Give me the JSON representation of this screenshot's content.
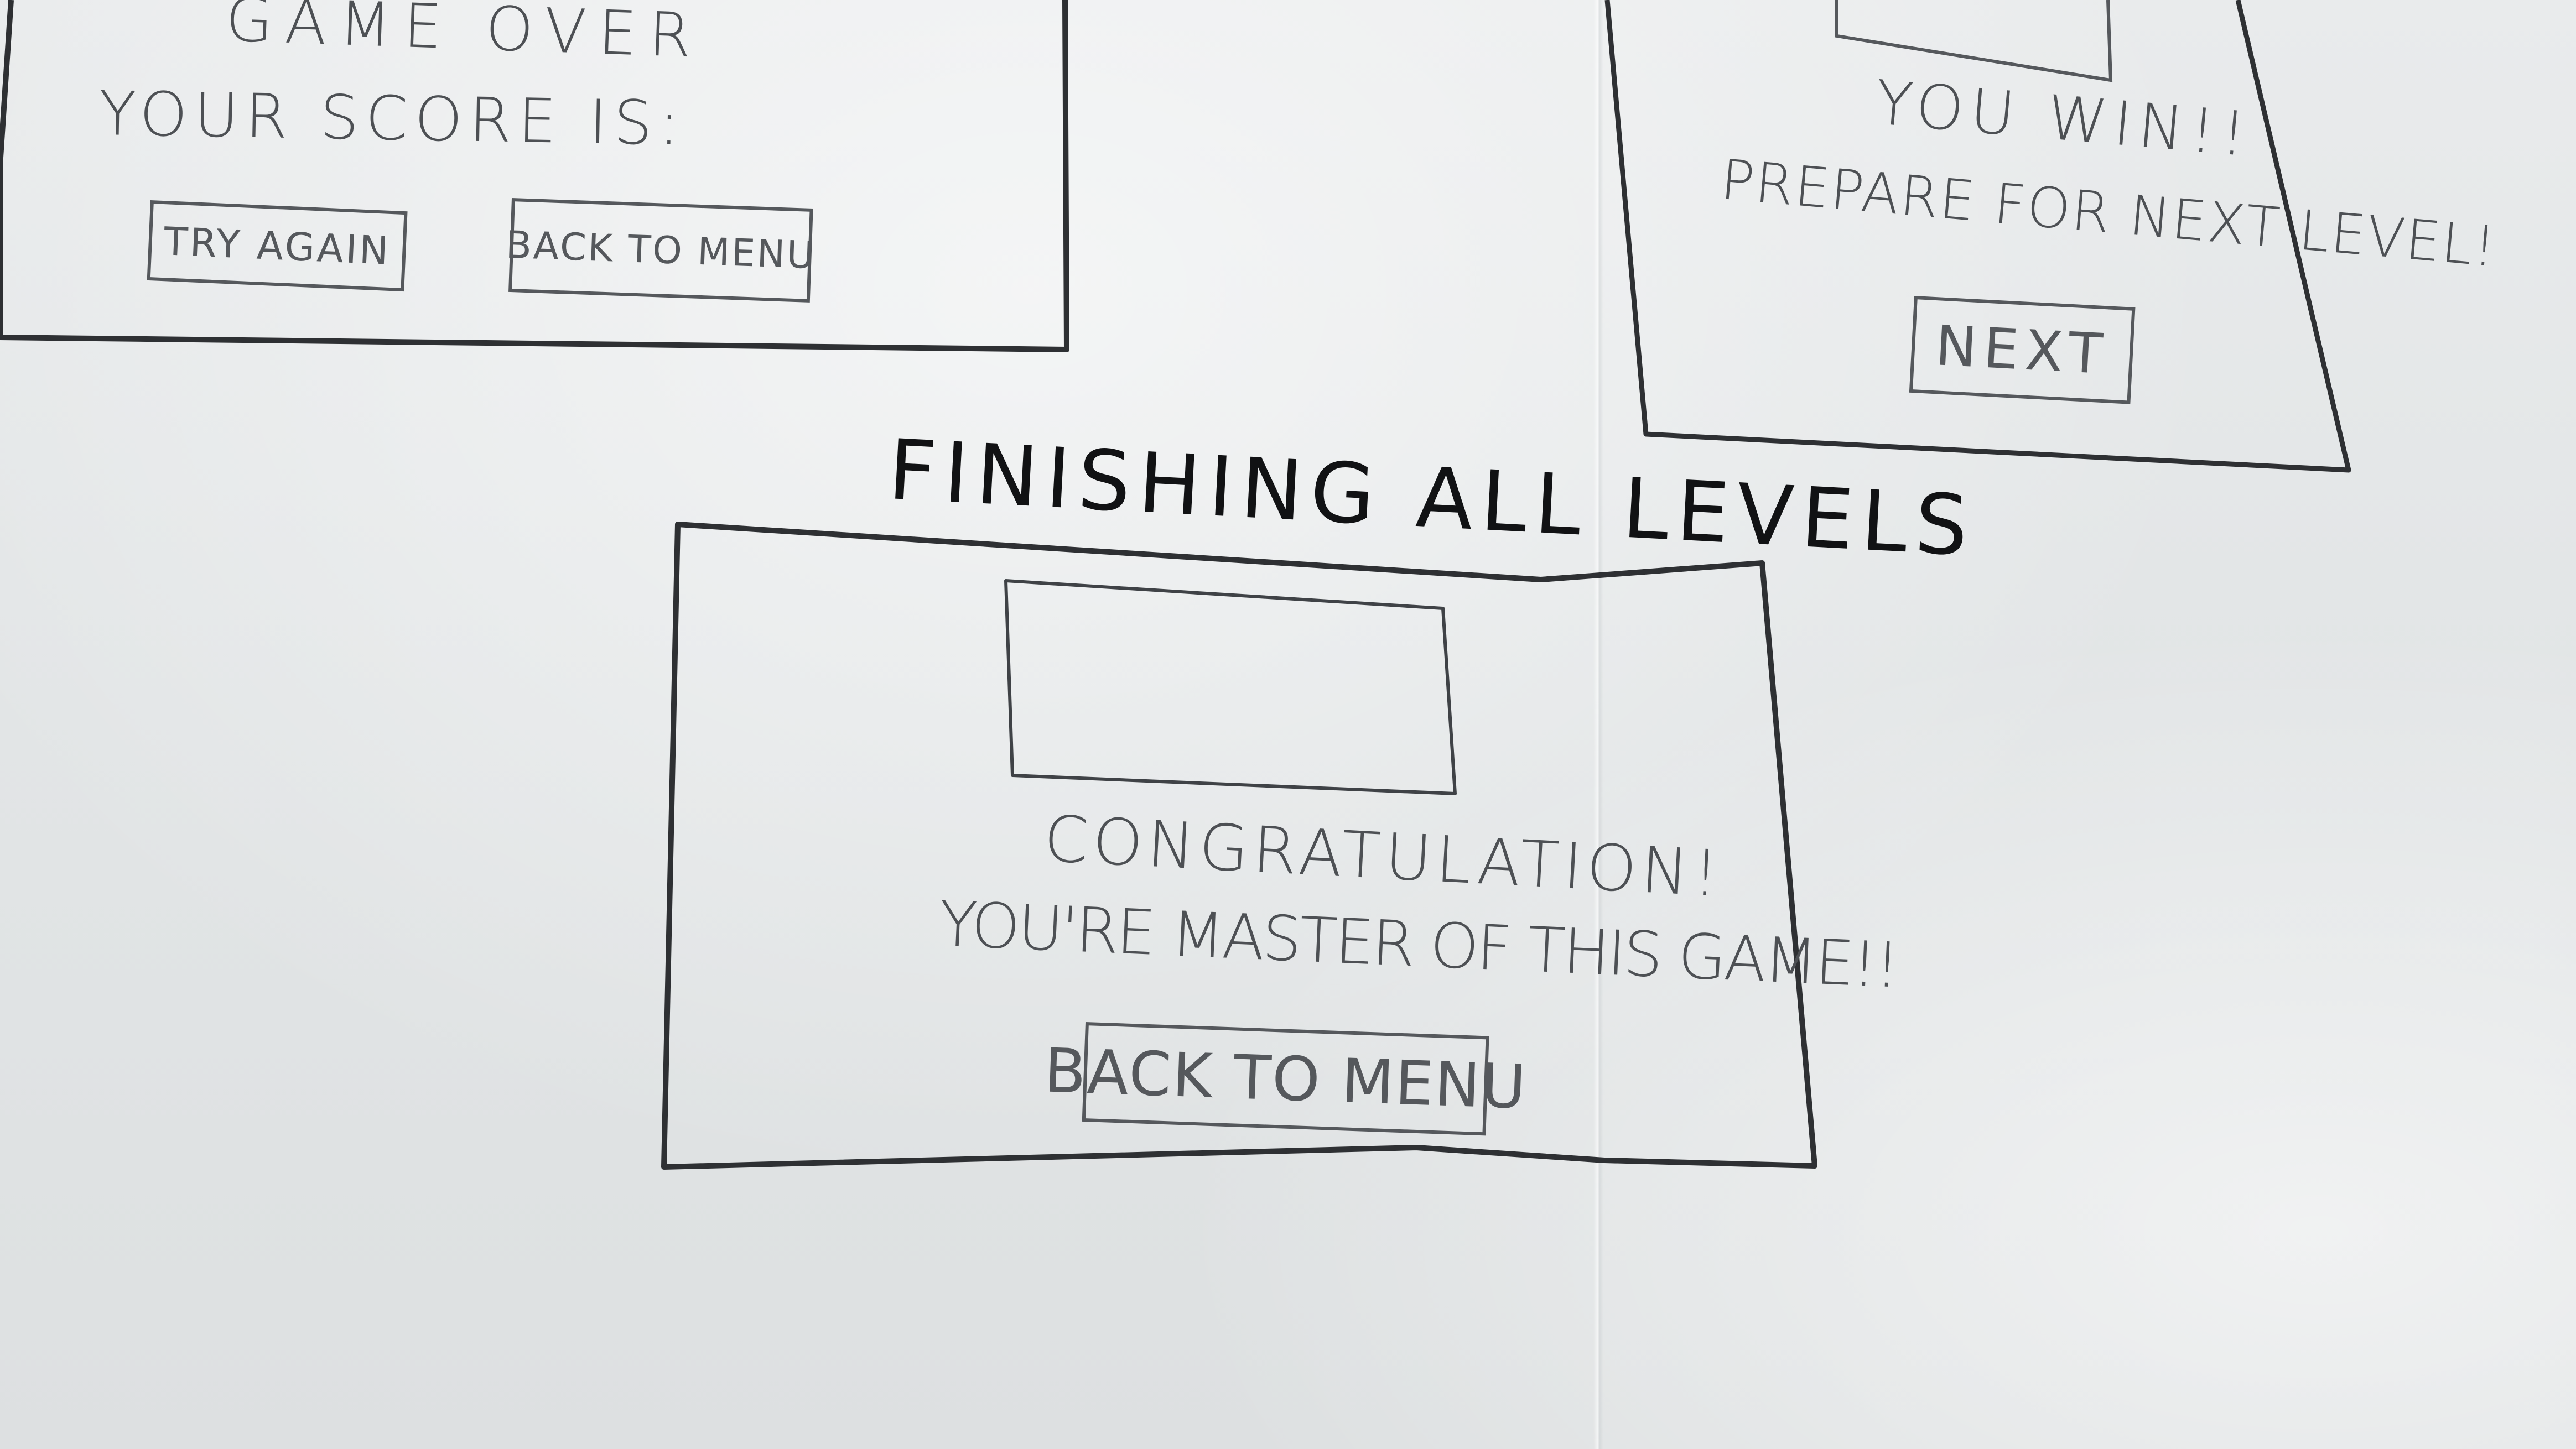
{
  "game_over_screen": {
    "heading": "GAME OVER",
    "score_label": "YOUR SCORE IS:",
    "try_again_label": "TRY AGAIN",
    "back_to_menu_label": "BACK TO MENU"
  },
  "win_screen": {
    "message": "YOU WIN!!",
    "prepare_text": "PREPARE FOR NEXT LEVEL!",
    "next_label": "NEXT"
  },
  "finish_screen": {
    "title": "FINISHING ALL LEVELS",
    "congrats": "CONGRATULATION!",
    "master_text": "YOU'RE MASTER OF THIS GAME!!",
    "back_to_menu_label": "BACK TO MENU"
  }
}
